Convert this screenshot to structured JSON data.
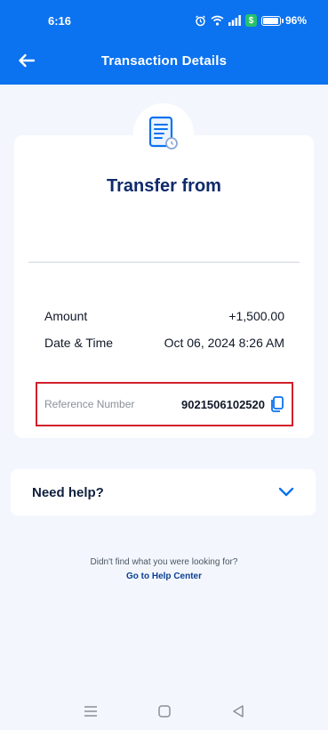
{
  "status_bar": {
    "time": "6:16",
    "battery_percent": "96%",
    "battery_level": 0.96
  },
  "header": {
    "title": "Transaction Details",
    "back_icon": "arrow-left-icon"
  },
  "transaction": {
    "icon": "receipt-icon",
    "title": "Transfer from",
    "amount_label": "Amount",
    "amount_value": "+1,500.00",
    "datetime_label": "Date & Time",
    "datetime_value": "Oct 06, 2024 8:26 AM",
    "reference_label": "Reference Number",
    "reference_value": "9021506102520",
    "copy_icon": "copy-icon",
    "highlight_color": "#d21f2b"
  },
  "help": {
    "label": "Need help?",
    "chevron_icon": "chevron-down-icon",
    "question": "Didn't find what you were looking for?",
    "link": "Go to Help Center"
  },
  "colors": {
    "header_bg": "#0b72f0",
    "title_text": "#0f2a6b",
    "page_bg": "#f3f7fd"
  },
  "nav_bar": {
    "icons": [
      "menu-icon",
      "home-square-icon",
      "back-triangle-icon"
    ]
  }
}
